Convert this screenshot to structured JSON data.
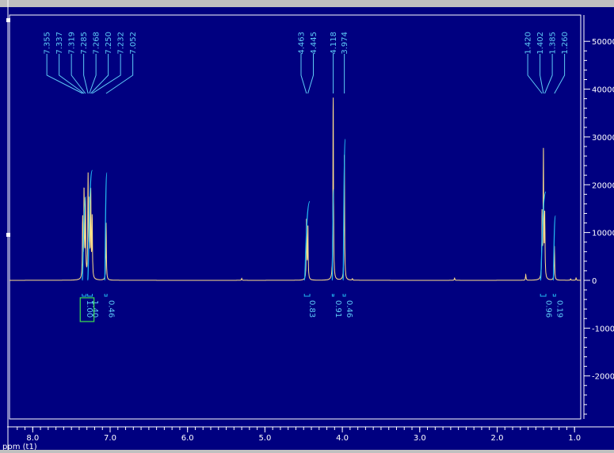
{
  "colors": {
    "plot_bg": "#000080",
    "frame": "#ffffff",
    "spectrum": "#ffe08a",
    "integral": "#22b8f0",
    "label": "#5ecbf7",
    "axis_text": "#ffffff",
    "selection_box": "#39d353",
    "outer_bg": "#c0c0c0"
  },
  "chart_data": {
    "type": "line",
    "title": "",
    "xlabel": "ppm (t1)",
    "ylabel": "",
    "x_reversed": true,
    "xlim": [
      8.3,
      0.92
    ],
    "ylim": [
      -290000,
      555000
    ],
    "x_ticks": [
      8.0,
      7.0,
      6.0,
      5.0,
      4.0,
      3.0,
      2.0,
      1.0
    ],
    "x_tick_labels": [
      "8.0",
      "7.0",
      "6.0",
      "5.0",
      "4.0",
      "3.0",
      "2.0",
      "1.0"
    ],
    "y_ticks": [
      500000,
      400000,
      300000,
      200000,
      100000,
      0,
      -100000,
      -200000
    ],
    "y_tick_labels": [
      "50000",
      "40000",
      "30000",
      "20000",
      "10000",
      "0",
      "-1000",
      "-2000"
    ],
    "peaks": [
      {
        "ppm": 7.355,
        "height": 125000
      },
      {
        "ppm": 7.337,
        "height": 180000
      },
      {
        "ppm": 7.319,
        "height": 160000
      },
      {
        "ppm": 7.285,
        "height": 210000
      },
      {
        "ppm": 7.268,
        "height": 150000
      },
      {
        "ppm": 7.25,
        "height": 175000
      },
      {
        "ppm": 7.232,
        "height": 125000
      },
      {
        "ppm": 7.052,
        "height": 120000
      },
      {
        "ppm": 4.463,
        "height": 125000
      },
      {
        "ppm": 4.445,
        "height": 110000
      },
      {
        "ppm": 4.118,
        "height": 382000
      },
      {
        "ppm": 3.974,
        "height": 262000
      },
      {
        "ppm": 1.42,
        "height": 135000
      },
      {
        "ppm": 1.402,
        "height": 265000
      },
      {
        "ppm": 1.385,
        "height": 130000
      },
      {
        "ppm": 1.26,
        "height": 72000
      },
      {
        "ppm": 5.3,
        "height": 4000
      },
      {
        "ppm": 3.87,
        "height": 3000
      },
      {
        "ppm": 2.55,
        "height": 5000
      },
      {
        "ppm": 1.63,
        "height": 12000
      },
      {
        "ppm": 1.05,
        "height": 3000
      },
      {
        "ppm": 0.98,
        "height": 5000
      }
    ],
    "peak_label_groups": [
      {
        "labels": [
          "7.355",
          "7.337",
          "7.319",
          "7.285",
          "7.268",
          "7.250",
          "7.232",
          "7.052"
        ],
        "ppm": [
          7.355,
          7.337,
          7.319,
          7.285,
          7.268,
          7.25,
          7.232,
          7.052
        ]
      },
      {
        "labels": [
          "4.463",
          "4.445"
        ],
        "ppm": [
          4.463,
          4.445
        ]
      },
      {
        "labels": [
          "4.118"
        ],
        "ppm": [
          4.118
        ]
      },
      {
        "labels": [
          "3.974"
        ],
        "ppm": [
          3.974
        ]
      },
      {
        "labels": [
          "1.420",
          "1.402",
          "1.385",
          "1.260"
        ],
        "ppm": [
          1.42,
          1.402,
          1.385,
          1.26
        ]
      }
    ],
    "integrals": [
      {
        "label": "1.00",
        "ppm": 7.335,
        "from": 7.36,
        "to": 7.31,
        "height": 175000,
        "boxed": true
      },
      {
        "label": "1.40",
        "ppm": 7.26,
        "from": 7.29,
        "to": 7.23,
        "height": 230000,
        "boxed": true
      },
      {
        "label": "0.46",
        "ppm": 7.05,
        "from": 7.07,
        "to": 7.04,
        "height": 225000,
        "boxed": false
      },
      {
        "label": "0.83",
        "ppm": 4.455,
        "from": 4.49,
        "to": 4.42,
        "height": 165000,
        "boxed": false
      },
      {
        "label": "0.91",
        "ppm": 4.118,
        "from": 4.13,
        "to": 4.11,
        "height": 190000,
        "boxed": false
      },
      {
        "label": "0.46",
        "ppm": 3.974,
        "from": 3.99,
        "to": 3.96,
        "height": 295000,
        "boxed": false
      },
      {
        "label": "0.96",
        "ppm": 1.4,
        "from": 1.44,
        "to": 1.37,
        "height": 185000,
        "boxed": false
      },
      {
        "label": "0.19",
        "ppm": 1.26,
        "from": 1.275,
        "to": 1.245,
        "height": 135000,
        "boxed": false
      }
    ]
  }
}
